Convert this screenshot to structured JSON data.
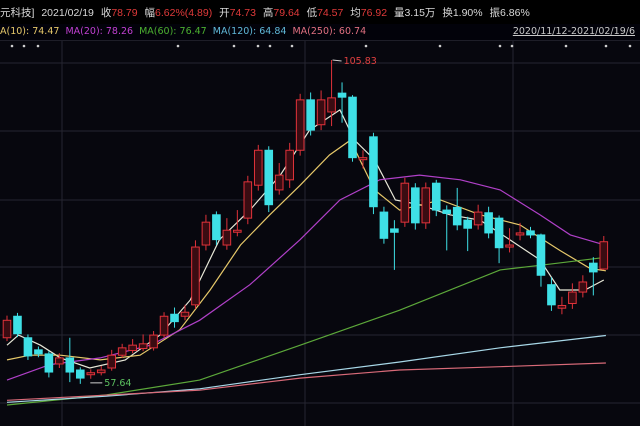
{
  "header": {
    "stock_name": "元科技]",
    "date": "2021/02/19",
    "close_label": "收",
    "close": "78.79",
    "change_label": "幅",
    "change": "6.62%(4.89)",
    "open_label": "开",
    "open": "74.73",
    "high_label": "高",
    "high": "79.64",
    "low_label": "低",
    "low": "74.57",
    "avg_label": "均",
    "avg": "76.92",
    "volume_label": "量",
    "volume": "3.15万",
    "turnover_label": "换",
    "turnover": "1.90%",
    "amplitude_label": "振",
    "amplitude": "6.86%"
  },
  "ma_legend": {
    "ma10": "A(10): 74.47",
    "ma20": "MA(20): 78.26",
    "ma60": "MA(60): 76.47",
    "ma120": "MA(120): 64.84",
    "ma250": "MA(250): 60.74",
    "range": "2020/11/12-2021/02/19/6"
  },
  "colors": {
    "up": "#e0323a",
    "down": "#3fe0e6",
    "ma5": "#e8e8d8",
    "ma10": "#e6c86a",
    "ma20": "#b040c8",
    "ma60": "#5ca83a",
    "ma120": "#a8d8e8",
    "ma250": "#d86a78"
  },
  "chart_data": {
    "type": "candlestick",
    "ylim": [
      51.37,
      114.76
    ],
    "max_label": "105.83",
    "min_label": "57.64",
    "max_index": 31,
    "min_index": 7,
    "candles": [
      [
        64.5,
        67.1,
        67.8,
        64.0
      ],
      [
        67.7,
        65.1,
        68.2,
        64.6
      ],
      [
        64.5,
        61.8,
        65.0,
        61.2
      ],
      [
        62.7,
        62.1,
        63.2,
        61.6
      ],
      [
        62.1,
        59.4,
        62.5,
        58.6
      ],
      [
        60.6,
        61.5,
        62.2,
        60.0
      ],
      [
        61.5,
        59.4,
        64.5,
        57.9
      ],
      [
        59.7,
        58.5,
        60.1,
        57.64
      ],
      [
        59.0,
        59.3,
        59.8,
        58.4
      ],
      [
        59.3,
        59.7,
        60.3,
        58.9
      ],
      [
        60.0,
        61.9,
        62.7,
        59.6
      ],
      [
        61.9,
        63.0,
        63.6,
        61.5
      ],
      [
        62.6,
        63.4,
        64.3,
        62.2
      ],
      [
        62.9,
        63.6,
        65.0,
        62.5
      ],
      [
        63.0,
        64.9,
        65.5,
        62.6
      ],
      [
        64.9,
        67.7,
        68.3,
        64.5
      ],
      [
        68.0,
        66.9,
        69.0,
        66.0
      ],
      [
        67.7,
        68.3,
        69.4,
        67.1
      ],
      [
        69.4,
        78.0,
        79.0,
        68.8
      ],
      [
        78.3,
        81.7,
        82.8,
        77.5
      ],
      [
        82.8,
        79.1,
        83.3,
        78.3
      ],
      [
        78.3,
        80.5,
        82.3,
        77.6
      ],
      [
        80.2,
        80.5,
        83.5,
        79.6
      ],
      [
        82.3,
        87.7,
        88.6,
        81.4
      ],
      [
        87.2,
        92.4,
        93.2,
        86.4
      ],
      [
        92.4,
        84.3,
        93.0,
        83.2
      ],
      [
        86.5,
        88.7,
        90.5,
        85.8
      ],
      [
        88.0,
        92.4,
        93.5,
        86.8
      ],
      [
        92.4,
        99.9,
        100.8,
        91.6
      ],
      [
        99.9,
        95.4,
        101.0,
        94.6
      ],
      [
        96.2,
        99.9,
        101.3,
        95.4
      ],
      [
        98.1,
        100.2,
        105.83,
        96.0
      ],
      [
        100.9,
        100.3,
        102.5,
        96.5
      ],
      [
        100.3,
        91.3,
        100.6,
        90.7
      ],
      [
        91.0,
        91.3,
        92.4,
        89.7
      ],
      [
        94.4,
        84.0,
        95.0,
        82.9
      ],
      [
        83.2,
        79.3,
        84.0,
        78.5
      ],
      [
        80.7,
        80.2,
        82.0,
        74.6
      ],
      [
        81.7,
        87.5,
        88.3,
        81.0
      ],
      [
        86.8,
        81.6,
        87.5,
        80.6
      ],
      [
        81.6,
        86.8,
        87.6,
        80.7
      ],
      [
        87.5,
        83.5,
        88.0,
        82.6
      ],
      [
        83.5,
        83.0,
        84.2,
        77.5
      ],
      [
        83.9,
        81.3,
        86.8,
        80.5
      ],
      [
        82.0,
        80.8,
        82.5,
        77.4
      ],
      [
        81.3,
        83.2,
        84.3,
        80.6
      ],
      [
        83.1,
        80.1,
        84.0,
        79.3
      ],
      [
        82.3,
        77.9,
        82.7,
        75.6
      ],
      [
        78.0,
        78.3,
        80.8,
        77.2
      ],
      [
        79.8,
        80.1,
        81.6,
        79.0
      ],
      [
        80.4,
        79.8,
        81.0,
        79.3
      ],
      [
        79.8,
        73.8,
        80.0,
        72.1
      ],
      [
        72.4,
        69.4,
        73.5,
        68.5
      ],
      [
        68.9,
        69.3,
        70.6,
        68.0
      ],
      [
        69.6,
        71.3,
        72.6,
        68.8
      ],
      [
        71.3,
        72.8,
        73.8,
        70.5
      ],
      [
        75.6,
        74.3,
        76.5,
        70.8
      ],
      [
        74.73,
        78.79,
        79.64,
        74.57
      ]
    ],
    "ma": {
      "ma5": [
        [
          0,
          63.4
        ],
        [
          1.1,
          64.9
        ],
        [
          3.2,
          63.4
        ],
        [
          5.1,
          61.5
        ],
        [
          7.9,
          60.0
        ],
        [
          11.3,
          61.2
        ],
        [
          14.6,
          64.9
        ],
        [
          17.5,
          70.1
        ],
        [
          20.3,
          79.1
        ],
        [
          23.2,
          83.5
        ],
        [
          26.1,
          88.7
        ],
        [
          28.9,
          95.4
        ],
        [
          31.8,
          98.4
        ],
        [
          33.2,
          93.9
        ],
        [
          35.1,
          91.0
        ],
        [
          37.1,
          85.0
        ],
        [
          39.4,
          84.3
        ],
        [
          42.3,
          82.8
        ],
        [
          45.2,
          82.0
        ],
        [
          48,
          79.1
        ],
        [
          50.9,
          76.1
        ],
        [
          52.8,
          71.6
        ],
        [
          55.2,
          71.6
        ],
        [
          57,
          73.1
        ]
      ],
      "ma10": [
        [
          0,
          61.2
        ],
        [
          2.2,
          61.9
        ],
        [
          5.1,
          61.9
        ],
        [
          8.9,
          61.2
        ],
        [
          12.7,
          61.9
        ],
        [
          16.5,
          65.7
        ],
        [
          19.4,
          71.6
        ],
        [
          22.3,
          78.3
        ],
        [
          25.1,
          82.8
        ],
        [
          28,
          87.2
        ],
        [
          30.8,
          91.7
        ],
        [
          32.8,
          93.9
        ],
        [
          35.1,
          86.5
        ],
        [
          37.5,
          83.5
        ],
        [
          41.4,
          85.0
        ],
        [
          45.2,
          82.8
        ],
        [
          49,
          81.3
        ],
        [
          52.8,
          77.5
        ],
        [
          55.7,
          74.8
        ],
        [
          57.2,
          74.47
        ]
      ],
      "ma20": [
        [
          0,
          58.2
        ],
        [
          4.1,
          60.5
        ],
        [
          8.9,
          61.5
        ],
        [
          13.7,
          63.4
        ],
        [
          18.4,
          67.1
        ],
        [
          23.2,
          72.4
        ],
        [
          28,
          79.1
        ],
        [
          31.8,
          85.0
        ],
        [
          35.6,
          88.0
        ],
        [
          39.4,
          88.7
        ],
        [
          43.3,
          88.0
        ],
        [
          47.1,
          86.5
        ],
        [
          50.9,
          82.8
        ],
        [
          53.8,
          79.8
        ],
        [
          57.2,
          78.26
        ]
      ],
      "ma60": [
        [
          0,
          54.5
        ],
        [
          9.5,
          56.0
        ],
        [
          18.4,
          58.2
        ],
        [
          28,
          63.4
        ],
        [
          37.5,
          68.6
        ],
        [
          47.1,
          74.6
        ],
        [
          51,
          75.3
        ],
        [
          57.2,
          76.47
        ]
      ],
      "ma120": [
        [
          0,
          54.9
        ],
        [
          9.5,
          55.8
        ],
        [
          18.4,
          56.9
        ],
        [
          28,
          59.0
        ],
        [
          37.5,
          60.9
        ],
        [
          47.1,
          63.0
        ],
        [
          57.2,
          64.84
        ]
      ],
      "ma250": [
        [
          0,
          55.2
        ],
        [
          18.4,
          56.7
        ],
        [
          28,
          58.5
        ],
        [
          37.5,
          59.7
        ],
        [
          47.1,
          60.2
        ],
        [
          57.2,
          60.74
        ]
      ]
    }
  }
}
